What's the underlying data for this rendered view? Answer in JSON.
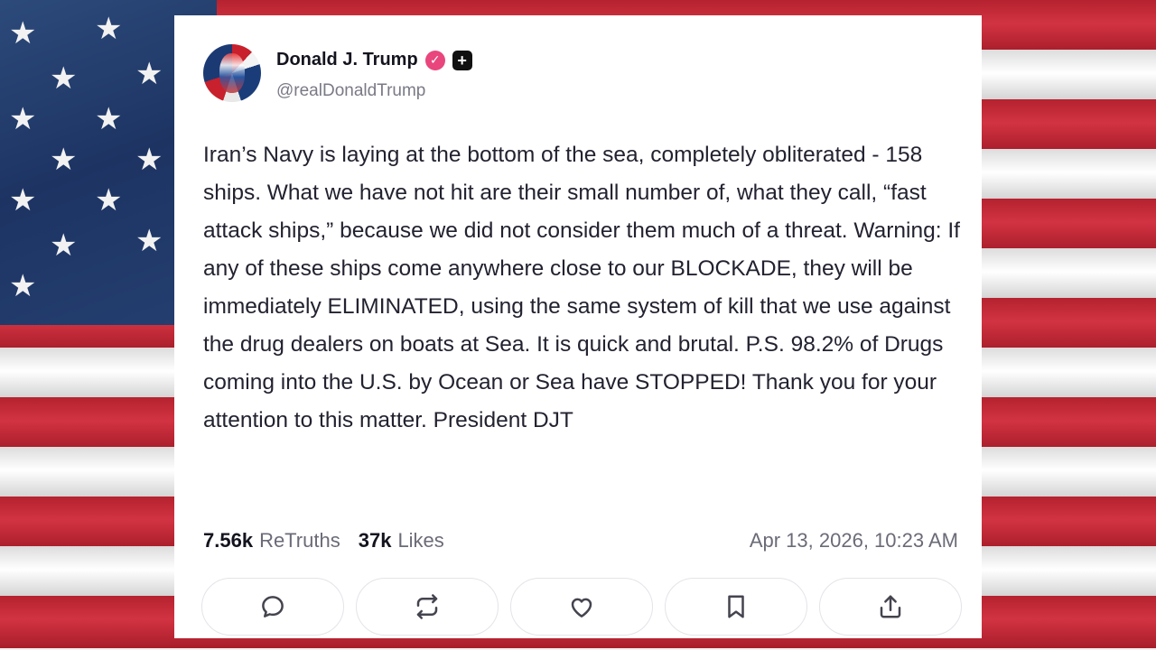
{
  "post": {
    "author_name": "Donald J. Trump",
    "verified_icon": "verified-badge-icon",
    "plus_icon": "plus-badge-icon",
    "handle": "@realDonaldTrump",
    "body": "Iran’s Navy is laying at the bottom of the sea, completely obliterated - 158 ships. What we have not hit are their small number of, what they call, “fast attack ships,” because we did not consider them much of a threat. Warning: If any of these ships come anywhere close to our BLOCKADE, they will be immediately ELIMINATED, using the same system of kill that we use against the drug dealers on boats at Sea. It is quick and brutal. P.S. 98.2% of Drugs coming into the U.S. by Ocean or Sea have STOPPED! Thank you for your attention to this matter. President DJT",
    "retruths_count": "7.56k",
    "retruths_label": "ReTruths",
    "likes_count": "37k",
    "likes_label": "Likes",
    "timestamp": "Apr 13, 2026, 10:23 AM"
  },
  "actions": [
    {
      "icon": "reply-icon"
    },
    {
      "icon": "retruth-icon"
    },
    {
      "icon": "like-icon"
    },
    {
      "icon": "bookmark-icon"
    },
    {
      "icon": "share-icon"
    }
  ],
  "colors": {
    "verified": "#e8467c",
    "text": "#222230",
    "muted": "#6b6b78",
    "flag_red": "#c8202c",
    "flag_blue": "#1d3463"
  }
}
